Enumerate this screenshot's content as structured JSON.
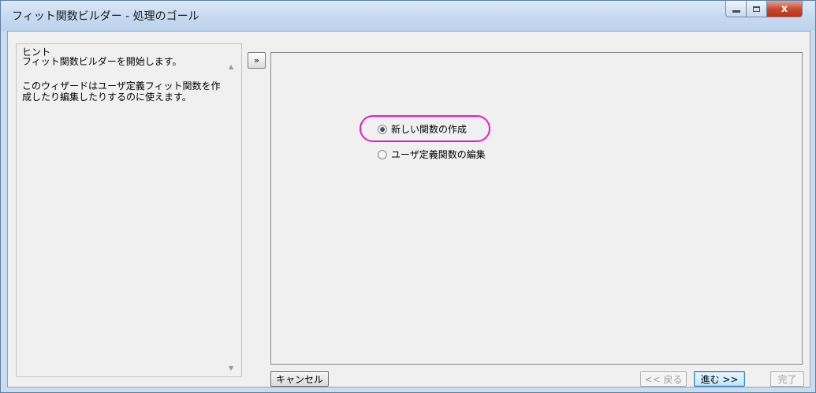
{
  "window": {
    "title": "フィット関数ビルダー - 処理のゴール",
    "close_glyph": "x"
  },
  "hint": {
    "label": "ヒント",
    "paragraphs": [
      "フィット関数ビルダーを開始します。",
      "このウィザードはユーザ定義フィット関数を作成したり編集したりするのに使えます。"
    ],
    "scroll_up": "▲",
    "scroll_down": "▼"
  },
  "expand_button": {
    "label": "»"
  },
  "options": [
    {
      "label": "新しい関数の作成",
      "checked": true,
      "highlighted": true
    },
    {
      "label": "ユーザ定義関数の編集",
      "checked": false
    }
  ],
  "buttons": {
    "cancel": "キャンセル",
    "back": "<< 戻る",
    "next": "進む >>",
    "finish": "完了"
  },
  "colors": {
    "highlight_ring": "#e11bd6",
    "titlebar": "#c6daf0",
    "close_button": "#c9462c"
  }
}
